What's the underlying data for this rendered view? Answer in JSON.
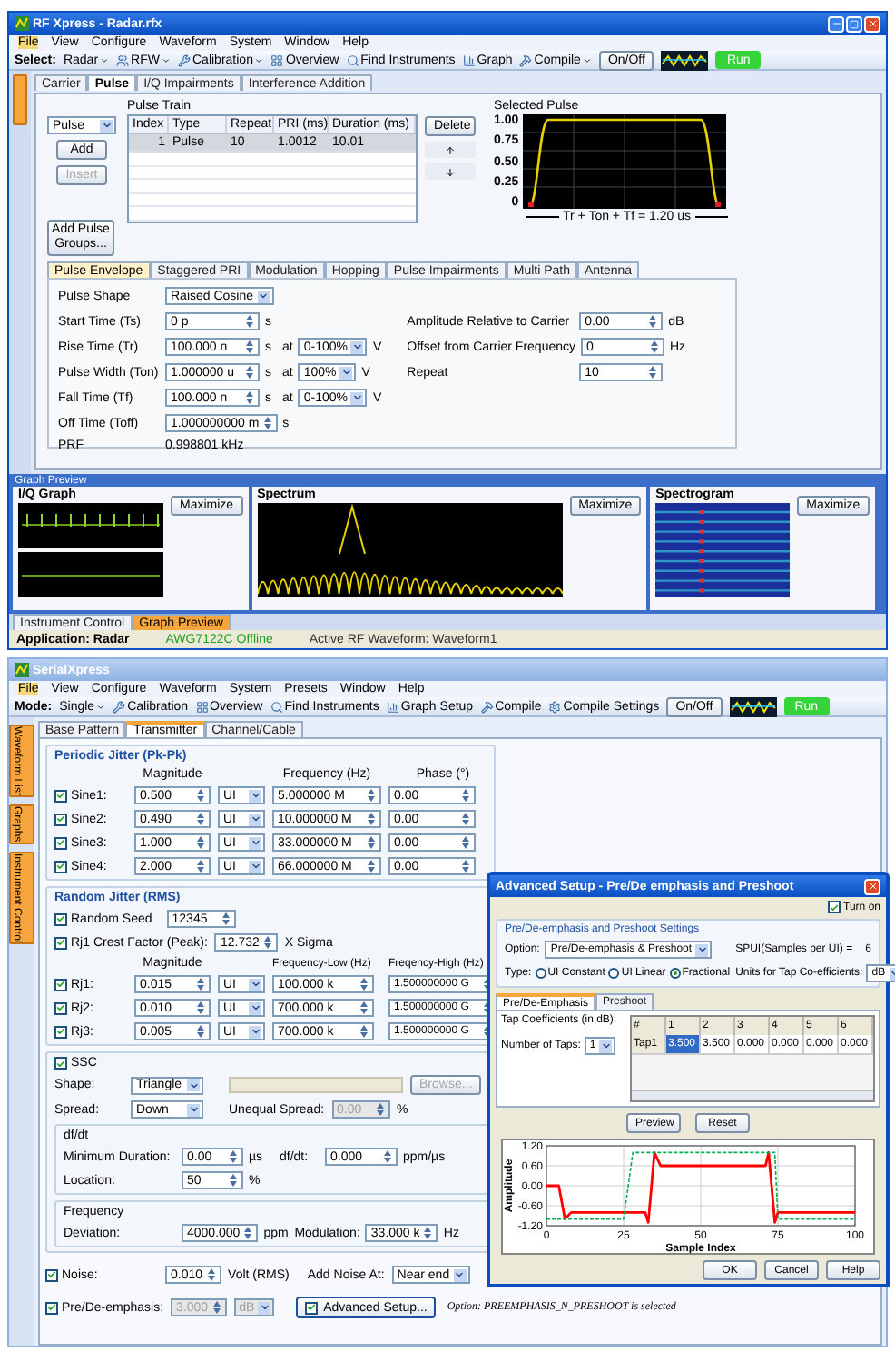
{
  "rf": {
    "title": "RF Xpress - Radar.rfx",
    "menu": [
      {
        "label": "File",
        "selected": true
      },
      {
        "label": "View",
        "selected": false
      },
      {
        "label": "Configure",
        "selected": false
      },
      {
        "label": "Waveform",
        "selected": false
      },
      {
        "label": "System",
        "selected": false
      },
      {
        "label": "Window",
        "selected": false
      },
      {
        "label": "Help",
        "selected": false
      }
    ],
    "toolbar": [
      {
        "kind": "label",
        "text": "Select:"
      },
      {
        "kind": "menu",
        "text": "Radar"
      },
      {
        "kind": "menu",
        "text": "RFW"
      },
      {
        "kind": "menu",
        "text": "Calibration"
      },
      {
        "kind": "button",
        "text": "Overview"
      },
      {
        "kind": "button",
        "text": "Find Instruments"
      },
      {
        "kind": "button",
        "text": "Graph"
      },
      {
        "kind": "menu",
        "text": "Compile"
      },
      {
        "kind": "toggle",
        "text": "On/Off"
      },
      {
        "kind": "scope"
      },
      {
        "kind": "run",
        "text": "Run"
      }
    ],
    "tabs": [
      {
        "label": "Carrier",
        "selected": false
      },
      {
        "label": "Pulse",
        "selected": true
      },
      {
        "label": "I/Q Impairments",
        "selected": false
      },
      {
        "label": "Interference Addition",
        "selected": false
      }
    ],
    "pulse_train": {
      "title": "Pulse Train",
      "type_value": "Pulse",
      "buttons": [
        {
          "label": "Add",
          "disabled": false
        },
        {
          "label": "Insert",
          "disabled": true
        }
      ],
      "groups_button": "Add Pulse Groups...",
      "columns": [
        "Index",
        "Type",
        "Repeat",
        "PRI (ms)",
        "Duration (ms)"
      ],
      "rows": [
        {
          "cells": [
            "1",
            "Pulse",
            "10",
            "1.0012",
            "10.01"
          ],
          "selected": true
        }
      ],
      "delete_button": "Delete"
    },
    "selected_pulse": {
      "title": "Selected Pulse",
      "y_labels": [
        "1.00",
        "0.75",
        "0.50",
        "0.25",
        "0"
      ],
      "caption": "Tr + Ton + Tf = 1.20 us"
    },
    "envelope_tabs": [
      {
        "label": "Pulse Envelope",
        "selected": true
      },
      {
        "label": "Staggered PRI",
        "selected": false
      },
      {
        "label": "Modulation",
        "selected": false
      },
      {
        "label": "Hopping",
        "selected": false
      },
      {
        "label": "Pulse Impairments",
        "selected": false
      },
      {
        "label": "Multi Path",
        "selected": false
      },
      {
        "label": "Antenna",
        "selected": false
      }
    ],
    "envelope_left": [
      {
        "kind": "combo",
        "label": "Pulse Shape",
        "value": "Raised Cosine"
      },
      {
        "kind": "spin",
        "label": "Start Time (Ts)",
        "value": "0 p",
        "unit": "s"
      },
      {
        "kind": "spin",
        "label": "Rise Time (Tr)",
        "value": "100.000 n",
        "unit": "s",
        "at": {
          "label": "at",
          "value": "0-100%",
          "unit": "V"
        }
      },
      {
        "kind": "spin",
        "label": "Pulse Width (Ton)",
        "value": "1.000000 u",
        "unit": "s",
        "at": {
          "label": "at",
          "value": "100%",
          "unit": "V"
        }
      },
      {
        "kind": "spin",
        "label": "Fall Time (Tf)",
        "value": "100.000 n",
        "unit": "s",
        "at": {
          "label": "at",
          "value": "0-100%",
          "unit": "V"
        }
      },
      {
        "kind": "spin",
        "label": "Off Time (Toff)",
        "value": "1.000000000 m",
        "unit": "s"
      },
      {
        "kind": "text",
        "label": "PRF",
        "value": "0.998801 kHz"
      }
    ],
    "envelope_right": [
      {
        "label": "Amplitude Relative to Carrier",
        "value": "0.00",
        "unit": "dB"
      },
      {
        "label": "Offset from Carrier Frequency",
        "value": "0",
        "unit": "Hz"
      },
      {
        "label": "Repeat",
        "value": "10"
      }
    ],
    "graph_preview": {
      "title": "Graph Preview",
      "panels": [
        {
          "kind": "iq",
          "title": "I/Q Graph",
          "button": "Maximize"
        },
        {
          "kind": "spectrum",
          "title": "Spectrum",
          "button": "Maximize"
        },
        {
          "kind": "spectrogram",
          "title": "Spectrogram",
          "button": "Maximize"
        }
      ]
    },
    "bottom_tabs": [
      {
        "label": "Instrument Control",
        "selected": false
      },
      {
        "label": "Graph Preview",
        "selected": true
      }
    ],
    "status_bar": [
      {
        "kind": "app",
        "text": "Application: Radar"
      },
      {
        "kind": "instrument",
        "text": "AWG7122C Offline"
      },
      {
        "kind": "plain",
        "text": "Active RF Waveform: Waveform1"
      }
    ]
  },
  "sx": {
    "title": "SerialXpress",
    "menu": [
      {
        "label": "File",
        "selected": true
      },
      {
        "label": "View",
        "selected": false
      },
      {
        "label": "Configure",
        "selected": false
      },
      {
        "label": "Waveform",
        "selected": false
      },
      {
        "label": "System",
        "selected": false
      },
      {
        "label": "Presets",
        "selected": false
      },
      {
        "label": "Window",
        "selected": false
      },
      {
        "label": "Help",
        "selected": false
      }
    ],
    "toolbar": [
      {
        "kind": "label",
        "text": "Mode:"
      },
      {
        "kind": "menu",
        "text": "Single"
      },
      {
        "kind": "button",
        "text": "Calibration"
      },
      {
        "kind": "button",
        "text": "Overview"
      },
      {
        "kind": "button",
        "text": "Find Instruments"
      },
      {
        "kind": "button",
        "text": "Graph Setup"
      },
      {
        "kind": "button",
        "text": "Compile"
      },
      {
        "kind": "button",
        "text": "Compile Settings"
      },
      {
        "kind": "toggle",
        "text": "On/Off"
      },
      {
        "kind": "scope"
      },
      {
        "kind": "run",
        "text": "Run"
      }
    ],
    "side_tabs": [
      "Waveform List",
      "Graphs",
      "Instrument Control"
    ],
    "tabs": [
      {
        "label": "Base Pattern",
        "selected": false
      },
      {
        "label": "Transmitter",
        "selected": true
      },
      {
        "label": "Channel/Cable",
        "selected": false
      }
    ],
    "periodic_jitter": {
      "title": "Periodic Jitter (Pk-Pk)",
      "headers": [
        "Magnitude",
        "Frequency (Hz)",
        "Phase (°)"
      ],
      "rows": [
        {
          "label": "Sine1:",
          "checked": true,
          "magnitude": "0.500",
          "unit": "UI",
          "frequency": "5.000000 M",
          "phase": "0.00"
        },
        {
          "label": "Sine2:",
          "checked": true,
          "magnitude": "0.490",
          "unit": "UI",
          "frequency": "10.000000 M",
          "phase": "0.00"
        },
        {
          "label": "Sine3:",
          "checked": true,
          "magnitude": "1.000",
          "unit": "UI",
          "frequency": "33.000000 M",
          "phase": "0.00"
        },
        {
          "label": "Sine4:",
          "checked": true,
          "magnitude": "2.000",
          "unit": "UI",
          "frequency": "66.000000 M",
          "phase": "0.00"
        }
      ]
    },
    "random_jitter": {
      "title": "Random Jitter (RMS)",
      "seed": {
        "label": "Random Seed",
        "checked": true,
        "value": "12345"
      },
      "crest": {
        "label": "Rj1 Crest Factor (Peak):",
        "checked": true,
        "value": "12.732",
        "unit": "X Sigma"
      },
      "headers": [
        "Magnitude",
        "Frequency-Low (Hz)",
        "Freqency-High (Hz)"
      ],
      "rows": [
        {
          "label": "Rj1:",
          "checked": true,
          "magnitude": "0.015",
          "unit": "UI",
          "low": "100.000 k",
          "high": "1.500000000 G"
        },
        {
          "label": "Rj2:",
          "checked": true,
          "magnitude": "0.010",
          "unit": "UI",
          "low": "700.000 k",
          "high": "1.500000000 G"
        },
        {
          "label": "Rj3:",
          "checked": true,
          "magnitude": "0.005",
          "unit": "UI",
          "low": "700.000 k",
          "high": "1.500000000 G"
        }
      ]
    },
    "ssc": {
      "label": "SSC",
      "checked": true,
      "shape": {
        "label": "Shape:",
        "value": "Triangle"
      },
      "browse": {
        "label": "Browse...",
        "disabled": true
      },
      "spread": {
        "label": "Spread:",
        "value": "Down"
      },
      "unequal": {
        "label": "Unequal Spread:",
        "value": "0.00",
        "unit": "%",
        "disabled": true
      },
      "dfdt_group": {
        "title": "df/dt",
        "min": {
          "label": "Minimum Duration:",
          "value": "0.00",
          "unit": "µs"
        },
        "dfdt": {
          "label": "df/dt:",
          "value": "0.000",
          "unit": "ppm/µs"
        },
        "location": {
          "label": "Location:",
          "value": "50",
          "unit": "%"
        }
      },
      "frequency_group": {
        "title": "Frequency",
        "deviation": {
          "label": "Deviation:",
          "value": "4000.000",
          "unit": "ppm"
        },
        "modulation": {
          "label": "Modulation:",
          "value": "33.000 k",
          "unit": "Hz"
        }
      }
    },
    "noise": {
      "label": "Noise:",
      "checked": true,
      "value": "0.010",
      "unit": "Volt (RMS)",
      "add_label": "Add Noise At:",
      "add_value": "Near end"
    },
    "pre_de": {
      "label": "Pre/De-emphasis:",
      "checked": true,
      "value": "3.000",
      "unit": "dB",
      "disabled": true,
      "advanced": {
        "label": "Advanced Setup...",
        "checked": true
      }
    },
    "note": "Option: PREEMPHASIS_N_PRESHOOT is selected"
  },
  "dialog": {
    "title": "Advanced Setup - Pre/De emphasis and Preshoot",
    "turn_on": {
      "label": "Turn on",
      "checked": true
    },
    "group_title": "Pre/De-emphasis and Preshoot Settings",
    "option": {
      "label": "Option:",
      "value": "Pre/De-emphasis & Preshoot"
    },
    "spui": {
      "label": "SPUI(Samples per UI) =",
      "value": "6"
    },
    "type_label": "Type:",
    "types": [
      {
        "label": "UI Constant",
        "selected": false
      },
      {
        "label": "UI Linear",
        "selected": false
      },
      {
        "label": "Fractional",
        "selected": true
      }
    ],
    "units": {
      "label": "Units for Tap Co-efficients:",
      "value": "dB"
    },
    "tabs": [
      {
        "label": "Pre/De-Emphasis",
        "selected": true
      },
      {
        "label": "Preshoot",
        "selected": false
      }
    ],
    "tap_label": "Tap Coefficients (in dB):",
    "taps": {
      "label": "Number of Taps:",
      "value": "1"
    },
    "columns": [
      "#",
      "1",
      "2",
      "3",
      "4",
      "5",
      "6"
    ],
    "rows": [
      {
        "label": "Tap1",
        "values": [
          {
            "text": "3.500",
            "selected": true
          },
          {
            "text": "3.500",
            "selected": false
          },
          {
            "text": "0.000",
            "selected": false
          },
          {
            "text": "0.000",
            "selected": false
          },
          {
            "text": "0.000",
            "selected": false
          },
          {
            "text": "0.000",
            "selected": false
          }
        ]
      }
    ],
    "buttons": [
      "Preview",
      "Reset"
    ],
    "chart_data": {
      "type": "line",
      "xlabel": "Sample Index",
      "ylabel": "Amplitude",
      "x": [
        0,
        4,
        6,
        8,
        10,
        25,
        28,
        32,
        33,
        35,
        37,
        45,
        70,
        71,
        72,
        74,
        75,
        77,
        80,
        100
      ],
      "grid": true,
      "series": [
        {
          "color": "#ff0000",
          "line_style": "solid",
          "values": [
            0,
            0,
            -1.0,
            -0.8,
            -0.8,
            -0.8,
            -0.8,
            -0.8,
            -1.1,
            1.0,
            0.6,
            0.6,
            0.6,
            0.6,
            1.0,
            -1.1,
            -0.8,
            -0.8,
            -0.8,
            -0.8
          ]
        },
        {
          "color": "#00b050",
          "line_style": "dashed",
          "values": [
            -1,
            -1,
            -1,
            -1,
            -1,
            -1,
            1,
            1,
            1,
            1,
            1,
            1,
            1,
            1,
            1,
            1,
            -1,
            -1,
            -1,
            -1
          ]
        }
      ],
      "xlim": [
        0,
        100
      ],
      "ylim": [
        -1.2,
        1.2
      ],
      "xticks": [
        0,
        25,
        50,
        75,
        100
      ],
      "yticks": [
        {
          "value": 1.2,
          "label": "1.20"
        },
        {
          "value": 0.6,
          "label": "0.60"
        },
        {
          "value": 0,
          "label": "0.00"
        },
        {
          "value": -0.6,
          "label": "-0.60"
        },
        {
          "value": -1.2,
          "label": "-1.20"
        }
      ]
    },
    "footer_buttons": [
      "OK",
      "Cancel",
      "Help"
    ]
  }
}
